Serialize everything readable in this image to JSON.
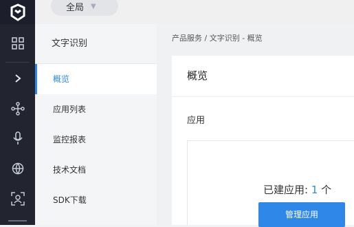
{
  "topbar": {
    "scope_label": "全局"
  },
  "sidebar": {
    "product_title": "文字识别",
    "items": [
      {
        "label": "概览",
        "active": true
      },
      {
        "label": "应用列表"
      },
      {
        "label": "监控报表"
      },
      {
        "label": "技术文档"
      },
      {
        "label": "SDK下载"
      }
    ]
  },
  "rail": {
    "icons": [
      "logo-icon",
      "grid-icon",
      "chevron-right-icon",
      "network-icon",
      "microphone-icon",
      "globe-icon",
      "face-scan-icon"
    ]
  },
  "breadcrumb": "产品服务  /  文字识别 - 概览",
  "main": {
    "card_title": "概览",
    "section_title": "应用",
    "created_label": "已建应用:",
    "created_count": "1",
    "created_unit": "个",
    "manage_button": "管理应用"
  },
  "colors": {
    "accent": "#2f87e8",
    "rail_bg": "#22252f"
  }
}
